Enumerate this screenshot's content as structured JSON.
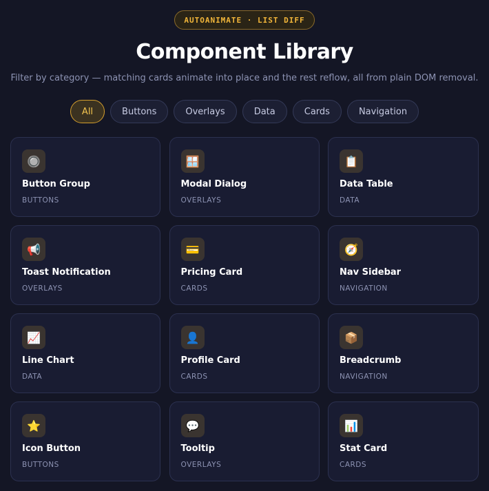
{
  "header": {
    "badge": "AUTOANIMATE · LIST DIFF",
    "title": "Component Library",
    "subtitle": "Filter by category — matching cards animate into place and the rest reflow, all from plain DOM removal."
  },
  "filters": [
    {
      "label": "All",
      "active": true
    },
    {
      "label": "Buttons",
      "active": false
    },
    {
      "label": "Overlays",
      "active": false
    },
    {
      "label": "Data",
      "active": false
    },
    {
      "label": "Cards",
      "active": false
    },
    {
      "label": "Navigation",
      "active": false
    }
  ],
  "cards": [
    {
      "name": "Button Group",
      "category": "BUTTONS",
      "icon": "🔘",
      "icon_name": "radio-button-icon"
    },
    {
      "name": "Modal Dialog",
      "category": "OVERLAYS",
      "icon": "🪟",
      "icon_name": "window-icon"
    },
    {
      "name": "Data Table",
      "category": "DATA",
      "icon": "📋",
      "icon_name": "clipboard-icon"
    },
    {
      "name": "Toast Notification",
      "category": "OVERLAYS",
      "icon": "📢",
      "icon_name": "megaphone-icon"
    },
    {
      "name": "Pricing Card",
      "category": "CARDS",
      "icon": "💳",
      "icon_name": "credit-card-icon"
    },
    {
      "name": "Nav Sidebar",
      "category": "NAVIGATION",
      "icon": "🧭",
      "icon_name": "compass-icon"
    },
    {
      "name": "Line Chart",
      "category": "DATA",
      "icon": "📈",
      "icon_name": "chart-increasing-icon"
    },
    {
      "name": "Profile Card",
      "category": "CARDS",
      "icon": "👤",
      "icon_name": "user-silhouette-icon"
    },
    {
      "name": "Breadcrumb",
      "category": "NAVIGATION",
      "icon": "📦",
      "icon_name": "package-icon"
    },
    {
      "name": "Icon Button",
      "category": "BUTTONS",
      "icon": "⭐",
      "icon_name": "star-icon"
    },
    {
      "name": "Tooltip",
      "category": "OVERLAYS",
      "icon": "💬",
      "icon_name": "speech-bubble-icon"
    },
    {
      "name": "Stat Card",
      "category": "CARDS",
      "icon": "📊",
      "icon_name": "bar-chart-icon"
    }
  ]
}
